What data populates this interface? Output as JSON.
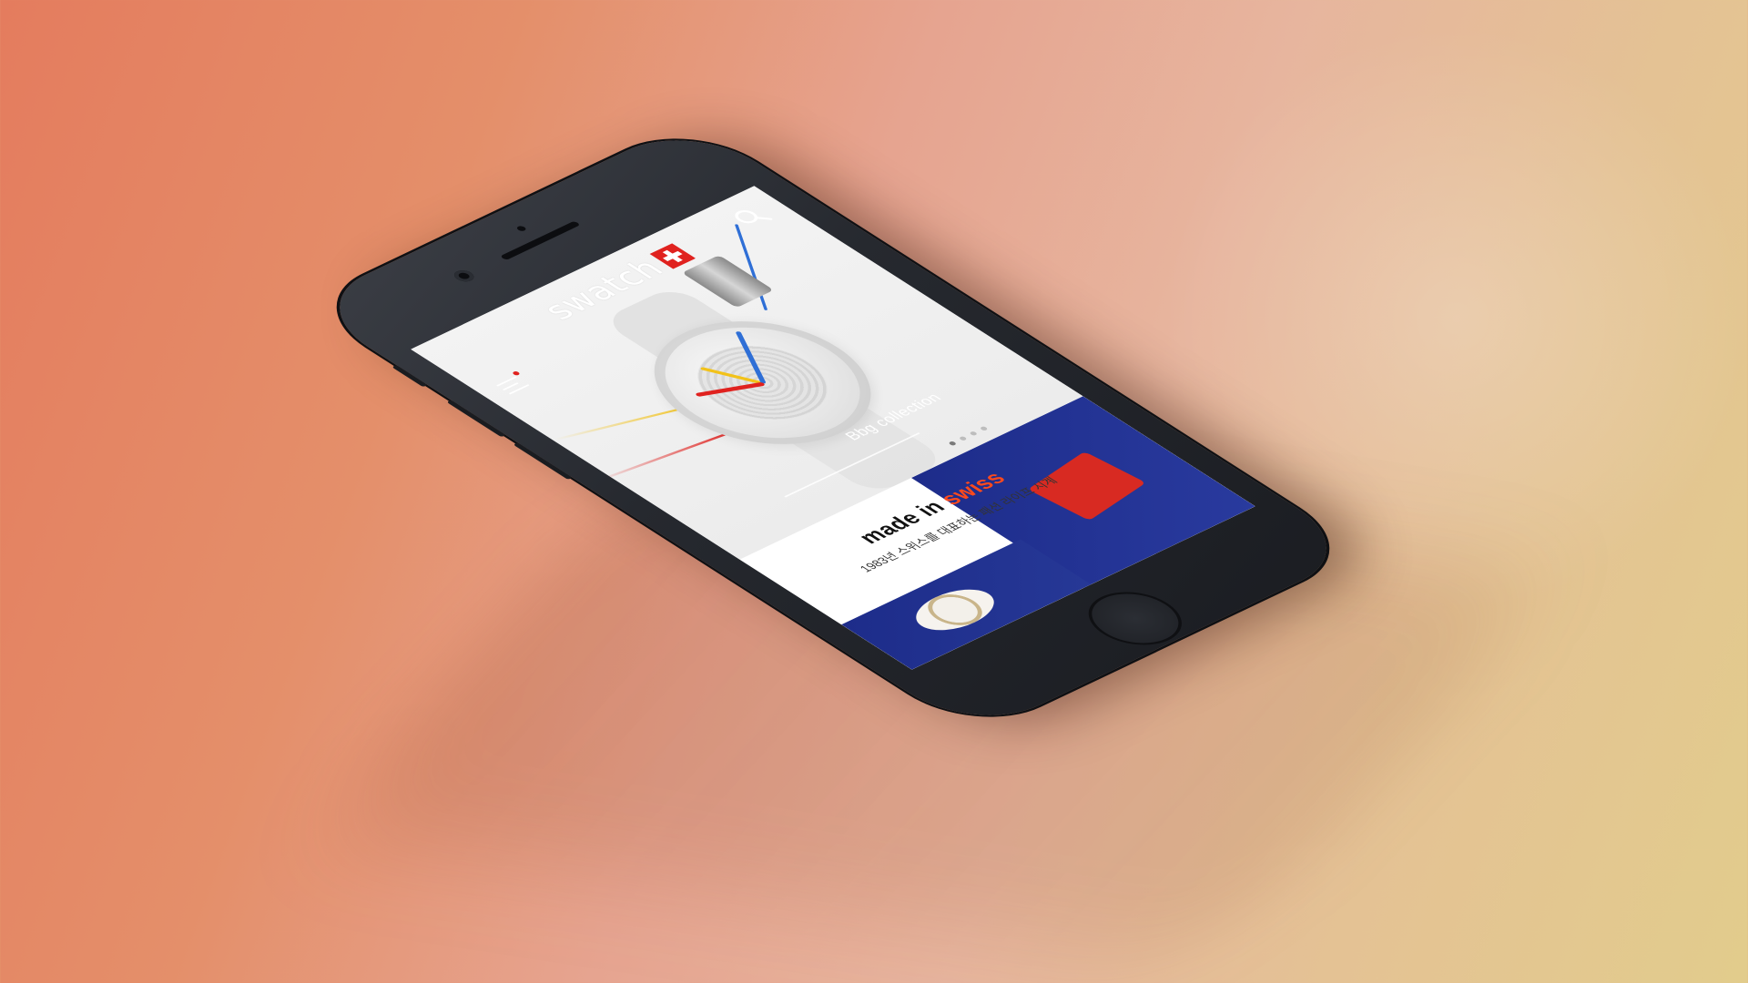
{
  "app": {
    "brand": "swatch"
  },
  "hero": {
    "caption": "Bbg collection",
    "slides": 4,
    "active_slide": 1
  },
  "banner": {
    "made_in": "made in",
    "swiss": "swiss",
    "subtitle": "1983년 스위스를 대표하는 패션 라이프 시계"
  },
  "icons": {
    "menu": "hamburger-menu-icon",
    "search": "search-icon",
    "flag": "swiss-cross-icon"
  },
  "colors": {
    "accent_red": "#e0221f",
    "swiss_orange": "#ff4a1c",
    "banner_blue": "#1d2c8a"
  }
}
